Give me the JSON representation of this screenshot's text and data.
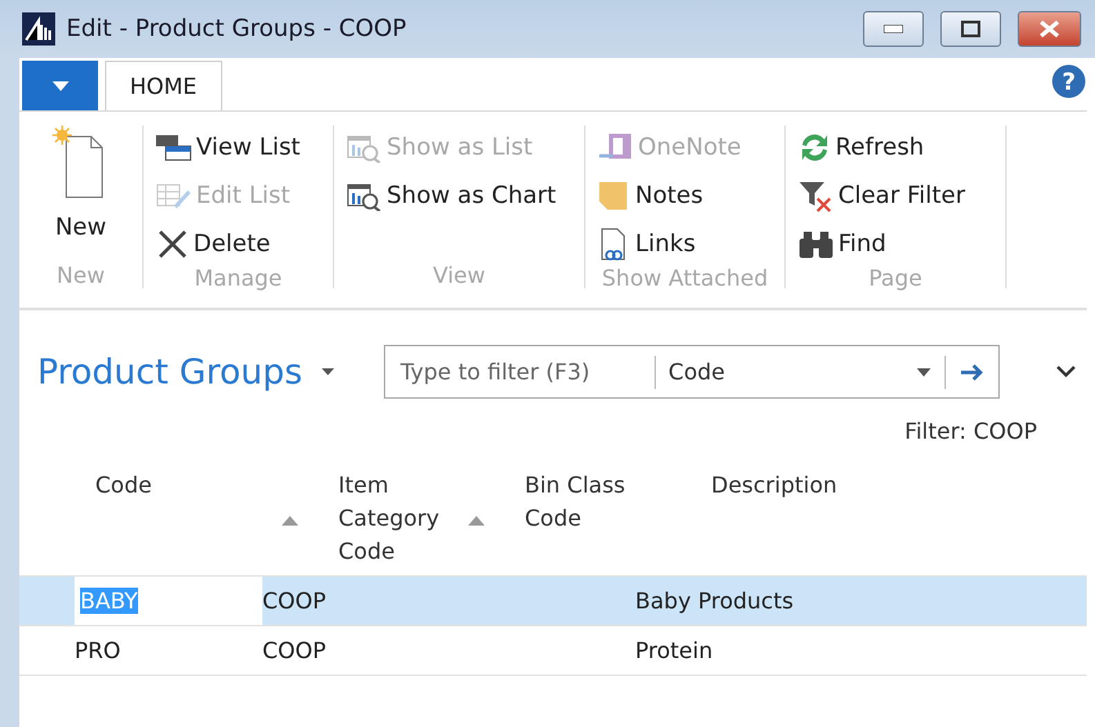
{
  "window": {
    "title": "Edit - Product Groups - COOP"
  },
  "tabs": [
    {
      "label": "HOME",
      "selected": true
    }
  ],
  "help": "?",
  "ribbon": [
    {
      "name": "New",
      "kind": "large",
      "items": [
        {
          "label": "New",
          "kind": "new",
          "disabled": false
        }
      ]
    },
    {
      "name": "Manage",
      "kind": "small",
      "items": [
        {
          "label": "View List",
          "kind": "viewlist",
          "disabled": false
        },
        {
          "label": "Edit List",
          "kind": "editlist",
          "disabled": true
        },
        {
          "label": "Delete",
          "kind": "delete",
          "disabled": false
        }
      ]
    },
    {
      "name": "View",
      "kind": "small",
      "items": [
        {
          "label": "Show as List",
          "kind": "showlist",
          "disabled": true
        },
        {
          "label": "Show as Chart",
          "kind": "showchart",
          "disabled": false
        }
      ]
    },
    {
      "name": "Show Attached",
      "kind": "small",
      "items": [
        {
          "label": "OneNote",
          "kind": "onenote",
          "disabled": true
        },
        {
          "label": "Notes",
          "kind": "notes",
          "disabled": false
        },
        {
          "label": "Links",
          "kind": "links",
          "disabled": false
        }
      ]
    },
    {
      "name": "Page",
      "kind": "small",
      "items": [
        {
          "label": "Refresh",
          "kind": "refresh",
          "disabled": false
        },
        {
          "label": "Clear Filter",
          "kind": "clearfilter",
          "disabled": false
        },
        {
          "label": "Find",
          "kind": "find",
          "disabled": false
        }
      ]
    }
  ],
  "page": {
    "title": "Product Groups",
    "filter": {
      "placeholder": "Type to filter (F3)",
      "field": "Code"
    },
    "filter_note": "Filter: COOP"
  },
  "table": {
    "columns": [
      {
        "label": "Code",
        "sorted": true
      },
      {
        "label": "Item Category Code",
        "sorted": true
      },
      {
        "label": "Bin Class Code",
        "sorted": false
      },
      {
        "label": "Description",
        "sorted": false
      }
    ],
    "rows": [
      {
        "cells": [
          "BABY",
          "COOP",
          "",
          "Baby Products"
        ],
        "selected": true
      },
      {
        "cells": [
          "PRO",
          "COOP",
          "",
          "Protein"
        ],
        "selected": false
      }
    ]
  }
}
